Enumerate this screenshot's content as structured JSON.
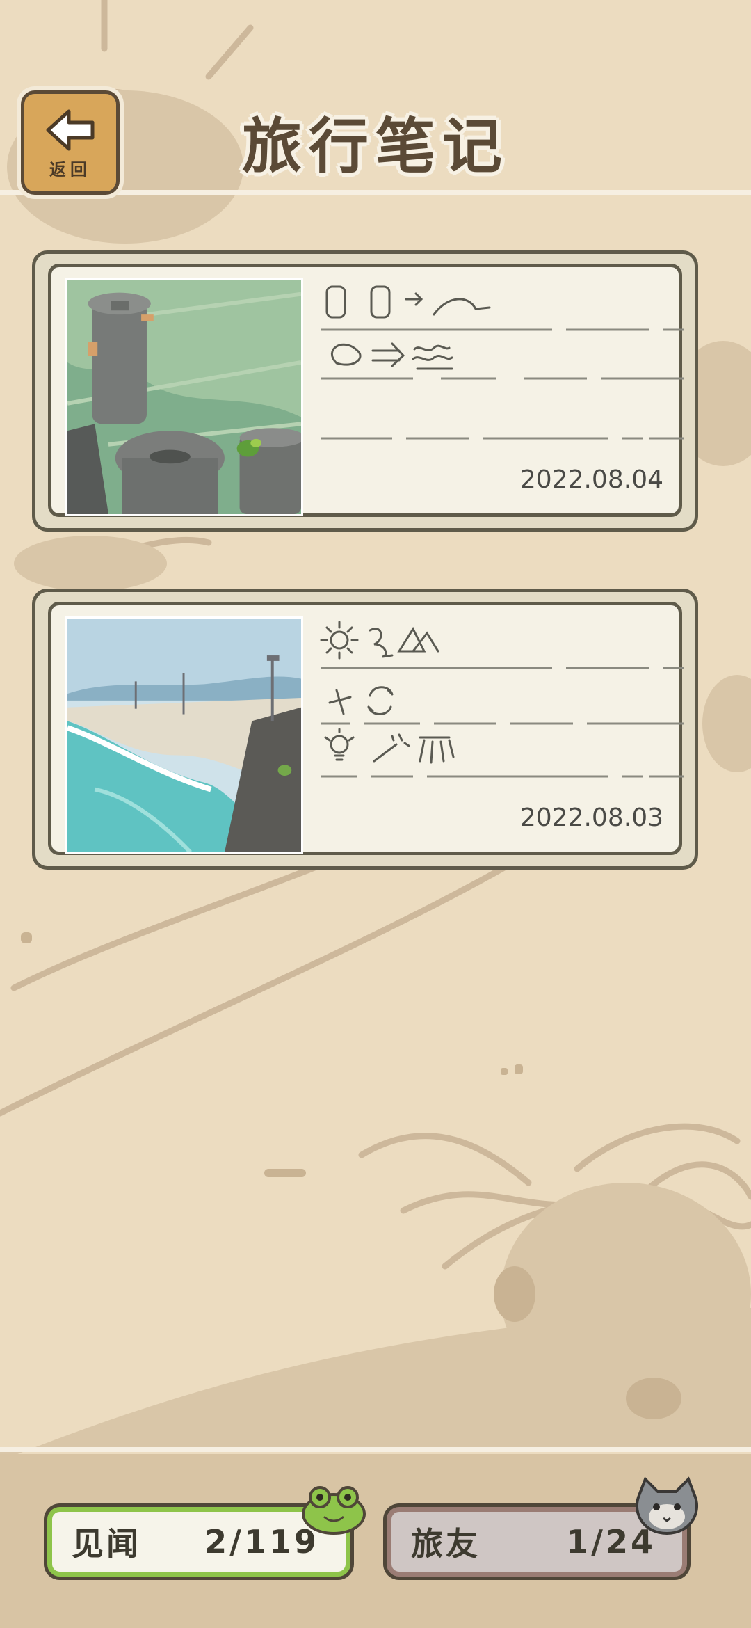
{
  "header": {
    "back_label": "返回",
    "title": "旅行笔记"
  },
  "notes": [
    {
      "date": "2022.08.04",
      "photo": "stone-lanterns-with-frog"
    },
    {
      "date": "2022.08.03",
      "photo": "seaside-promenade-with-snail"
    }
  ],
  "footer": {
    "sights_label": "见闻",
    "sights_count": "2/119",
    "friends_label": "旅友",
    "friends_count": "1/24"
  },
  "icons": {
    "back": "left-arrow-icon",
    "frog": "frog-badge-icon",
    "cat": "cat-badge-icon"
  },
  "colors": {
    "background": "#ecdcc0",
    "card_border": "#5f5b4a",
    "sights_accent": "#8ec44a",
    "friends_accent": "#9a7c74"
  }
}
